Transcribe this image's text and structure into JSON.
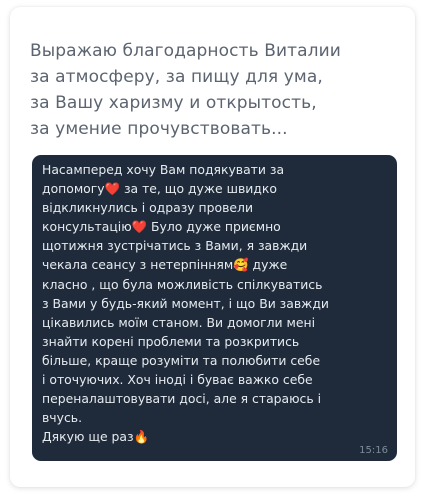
{
  "review": {
    "lines": [
      "Выражаю благодарность Виталии",
      "за атмосферу, за пищу для ума,",
      "за Вашу харизму и открытость,",
      "за умение прочувствовать..."
    ]
  },
  "message": {
    "lines": [
      "Насамперед хочу Вам подякувати за",
      "допомогу❤️ за те, що дуже швидко",
      "відкликнулись і одразу провели",
      "консультацію❤️ Було дуже приємно",
      "щотижня зустрічатись з Вами, я завжди",
      "чекала сеансу з нетерпінням🥰 дуже",
      "класно , що була можливість спілкуватись",
      "з Вами у будь-який момент, і що Ви завжди",
      "цікавились моїм станом. Ви домогли  мені",
      "знайти корені проблеми та розкритись",
      "більше, краще розуміти та полюбити себе",
      "і оточуючих. Хоч іноді і буває важко себе",
      "переналаштовувати досі, але я стараюсь і",
      "вчусь.",
      "Дякую ще раз🔥"
    ],
    "time": "15:16"
  }
}
